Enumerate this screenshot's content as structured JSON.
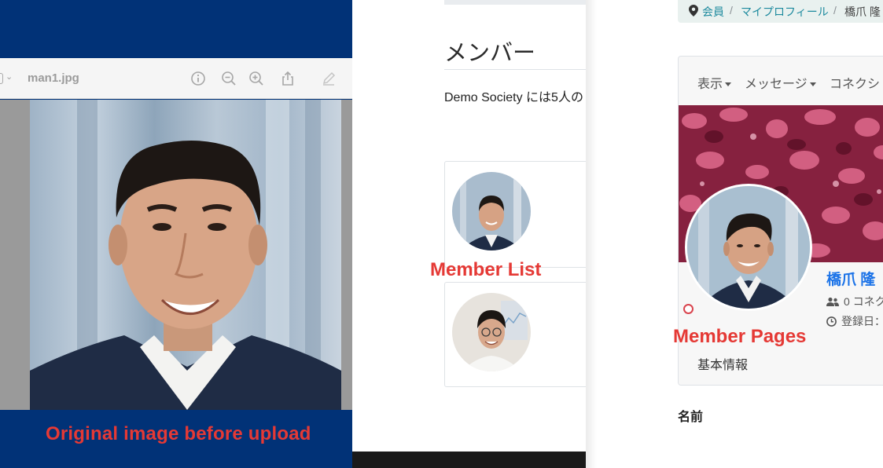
{
  "viewer": {
    "filename": "man1.jpg",
    "caption": "Original image before upload",
    "toolbar_icons": [
      "info-icon",
      "zoom-out-icon",
      "zoom-in-icon",
      "share-icon",
      "markup-pen-icon"
    ]
  },
  "member_list": {
    "heading": "メンバー",
    "count_text": "Demo Society には5人の",
    "caption": "Member List"
  },
  "profile_page": {
    "breadcrumb": {
      "items": [
        "会員",
        "マイプロフィール",
        "橋爪 隆"
      ],
      "separator": "/"
    },
    "nav": {
      "view": "表示",
      "messages": "メッセージ",
      "connections": "コネクシ"
    },
    "name": "橋爪 隆",
    "connections_text": "0 コネク",
    "registered_text": "登録日：",
    "caption": "Member Pages",
    "section_basic": "基本情報",
    "field_name_label": "名前"
  },
  "colors": {
    "caption_red": "#e53935",
    "panel_navy": "#013277",
    "link_teal": "#1d8a9e",
    "name_blue": "#1d74e8"
  }
}
